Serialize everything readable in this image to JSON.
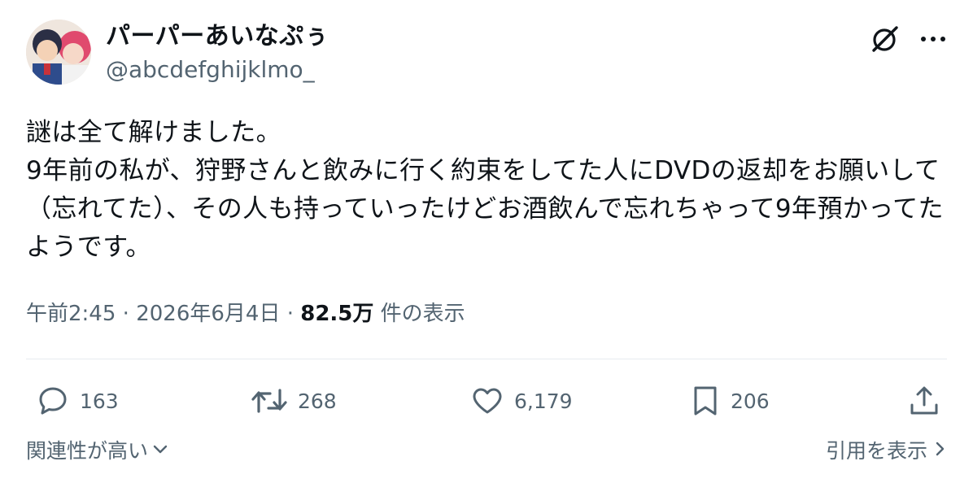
{
  "author": {
    "display_name": "パーパーあいなぷぅ",
    "handle": "@abcdefghijklmo_"
  },
  "post": {
    "text": "謎は全て解けました。\n9年前の私が、狩野さんと飲みに行く約束をしてた人にDVDの返却をお願いして（忘れてた）、その人も持っていったけどお酒飲んで忘れちゃって9年預かってたようです。",
    "time": "午前2:45",
    "separator": "·",
    "date": "2026年6月4日",
    "views_count": "82.5万",
    "views_label": "件の表示"
  },
  "actions": {
    "replies": "163",
    "reposts": "268",
    "likes": "6,179",
    "bookmarks": "206"
  },
  "footer": {
    "sort_label": "関連性が高い",
    "quotes_label": "引用を表示"
  },
  "colors": {
    "text": "#0f1419",
    "secondary": "#536471",
    "divider": "#e6ecf0"
  },
  "icons": {
    "grok": "grok-icon",
    "more": "more-icon",
    "reply": "reply-icon",
    "repost": "repost-icon",
    "like": "heart-icon",
    "bookmark": "bookmark-icon",
    "share": "share-icon"
  }
}
